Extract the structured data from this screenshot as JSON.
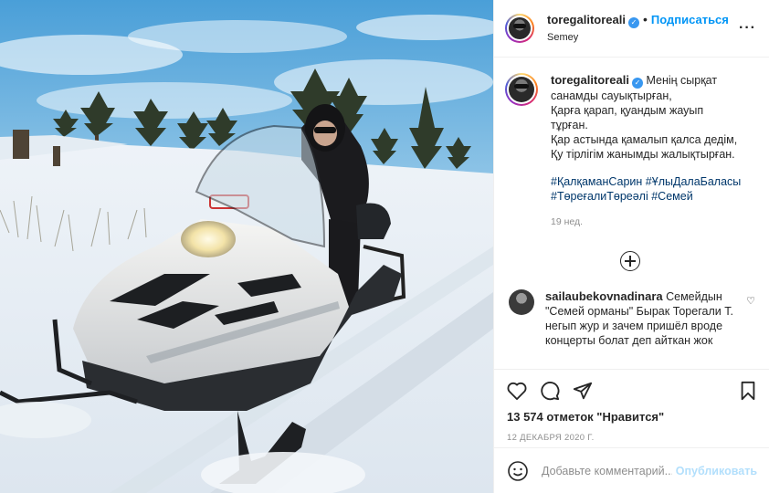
{
  "post": {
    "username": "toregalitoreali",
    "verified_icon": "verified-badge-icon",
    "separator": "•",
    "follow_label": "Подписаться",
    "location": "Semey",
    "more_icon": "more-options-icon",
    "caption_username": "toregalitoreali",
    "caption_lines": [
      "Менің сырқат",
      "санамды сауықтырған,",
      "Қарға қарап, қуандым жауып",
      "тұрған.",
      "Қар астында қамалып қалса дедім,",
      "Қу тірлігім жанымды жалықтырған."
    ],
    "hashtags": [
      "#ҚалқаманСарин",
      "#ҰлыДалаБаласы",
      "#ТөреғалиТөреәлі",
      "#Семей"
    ],
    "time_ago": "19 нед.",
    "load_more_icon": "plus-circle-icon"
  },
  "comment": {
    "username": "sailaubekovnadinara",
    "text": "Семейдын \"Семей орманы\" Бырак Торегали Т. негып жур и зачем пришёл вроде концерты болат деп айткан жок",
    "like_icon": "heart-small-icon"
  },
  "actions": {
    "like_icon": "heart-icon",
    "comment_icon": "comment-icon",
    "share_icon": "share-icon",
    "save_icon": "bookmark-icon",
    "likes_text": "13 574 отметок \"Нравится\"",
    "date": "12 ДЕКАБРЯ 2020 Г."
  },
  "add_comment": {
    "emoji_icon": "emoji-icon",
    "placeholder": "Добавьте комментарий...",
    "publish_label": "Опубликовать"
  },
  "colors": {
    "link": "#0095f6",
    "hashtag": "#00376b",
    "muted": "#8e8e8e",
    "publish_disabled": "#b2dffc"
  }
}
